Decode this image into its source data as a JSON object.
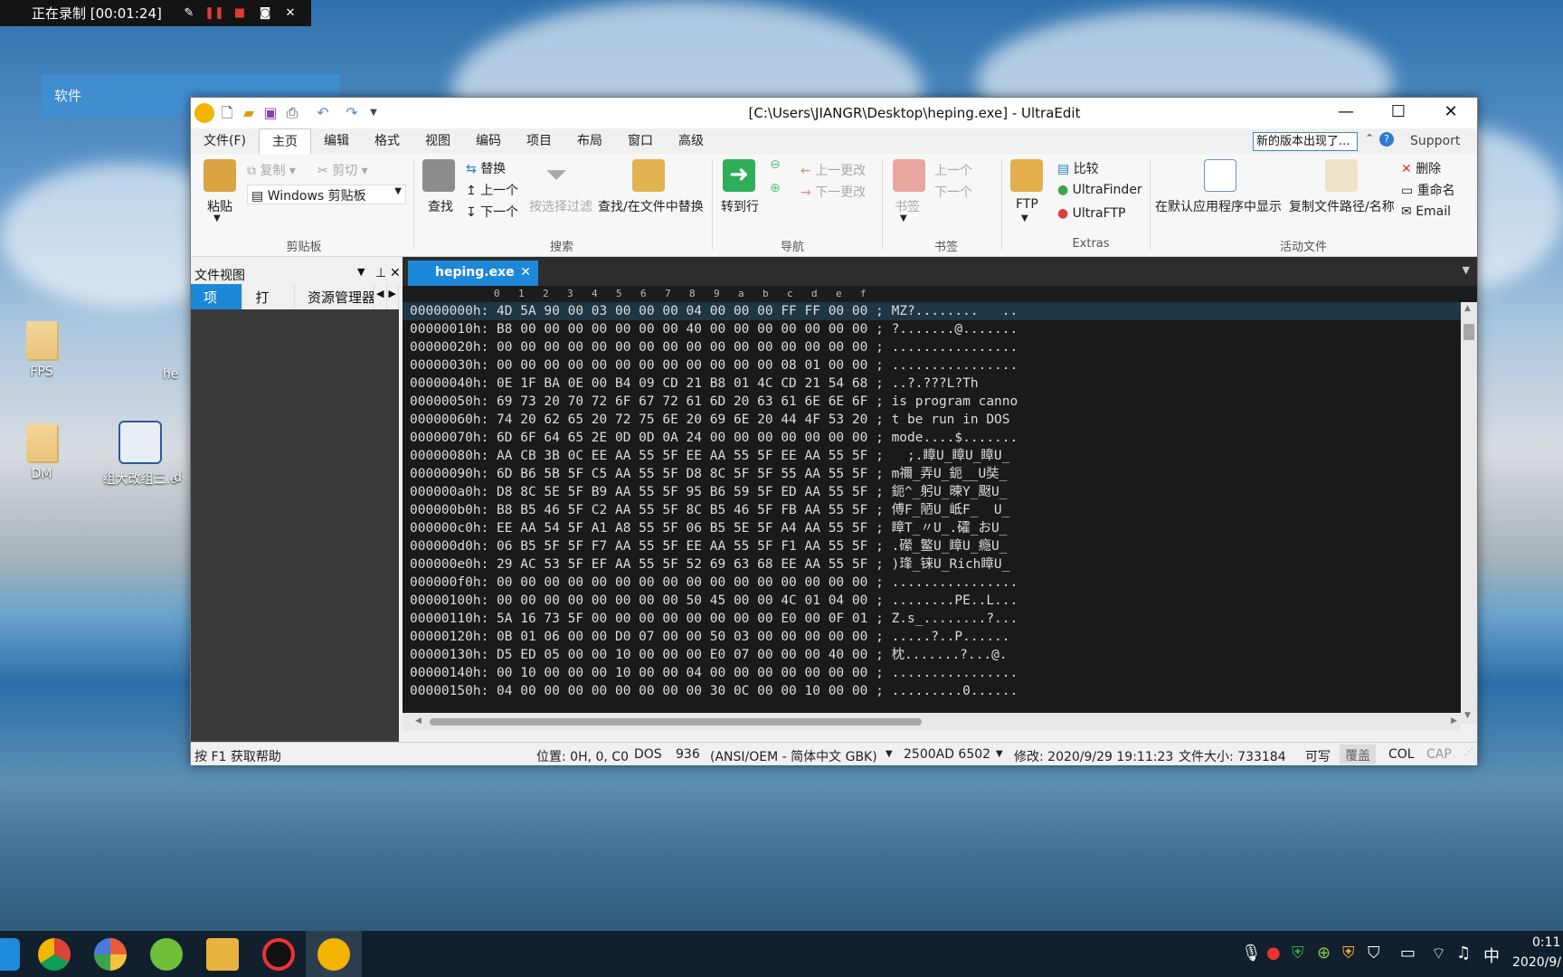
{
  "recorder": {
    "status": "正在录制 [00:01:24]",
    "buttons": [
      "pen-icon",
      "pause-icon",
      "stop-icon",
      "camera-icon",
      "close-icon"
    ]
  },
  "desktop": {
    "software_panel_label": "软件",
    "icons": [
      {
        "name": "FPS",
        "kind": "folder"
      },
      {
        "name": "DM",
        "kind": "folder"
      },
      {
        "name": "组大改组三.e",
        "kind": "app"
      },
      {
        "name": "he",
        "kind": "file"
      },
      {
        "name": "d",
        "kind": "file"
      }
    ]
  },
  "window": {
    "title": "[C:\\Users\\JIANGR\\Desktop\\heping.exe] - UltraEdit",
    "controls": {
      "minimize": "—",
      "maximize": "☐",
      "close": "✕"
    },
    "menu": [
      "文件(F)",
      "主页",
      "编辑",
      "格式",
      "视图",
      "编码",
      "项目",
      "布局",
      "窗口",
      "高级"
    ],
    "active_menu": "主页",
    "notice": "新的版本出现了...",
    "support": "Support"
  },
  "ribbon": {
    "clipboard": {
      "paste": "粘贴",
      "copy": "复制",
      "cut": "剪切",
      "clipboard_select": "Windows 剪贴板",
      "group": "剪贴板"
    },
    "search": {
      "find": "查找",
      "replace": "替换",
      "prev": "上一个",
      "next": "下一个",
      "filter": "按选择过滤",
      "find_in_files": "查找/在文件中替换",
      "group": "搜索"
    },
    "navigation": {
      "goto": "转到行",
      "prev_change": "上一更改",
      "next_change": "下一更改",
      "group": "导航"
    },
    "bookmarks": {
      "bookmark": "书签",
      "prev": "上一个",
      "next": "下一个",
      "group": "书签"
    },
    "extras": {
      "ftp": "FTP",
      "compare": "比较",
      "finder": "UltraFinder",
      "ultraftp": "UltraFTP",
      "group": "Extras"
    },
    "active_file": {
      "show_default": "在默认应用程序中显示",
      "copy_path": "复制文件路径/名称",
      "delete": "删除",
      "rename": "重命名",
      "email": "Email",
      "group": "活动文件"
    }
  },
  "file_view": {
    "title": "文件视图",
    "tabs": [
      "项目",
      "打开",
      "资源管理器"
    ],
    "active_tab": "项目"
  },
  "editor": {
    "tab_name": "heping.exe",
    "ruler": [
      "0",
      "1",
      "2",
      "3",
      "4",
      "5",
      "6",
      "7",
      "8",
      "9",
      "a",
      "b",
      "c",
      "d",
      "e",
      "f"
    ],
    "rows": [
      {
        "addr": "00000000h:",
        "hex": "4D 5A 90 00 03 00 00 00 04 00 00 00 FF FF 00 00",
        "ascii": "MZ?........   .."
      },
      {
        "addr": "00000010h:",
        "hex": "B8 00 00 00 00 00 00 00 40 00 00 00 00 00 00 00",
        "ascii": "?.......@......."
      },
      {
        "addr": "00000020h:",
        "hex": "00 00 00 00 00 00 00 00 00 00 00 00 00 00 00 00",
        "ascii": "................"
      },
      {
        "addr": "00000030h:",
        "hex": "00 00 00 00 00 00 00 00 00 00 00 00 08 01 00 00",
        "ascii": "................"
      },
      {
        "addr": "00000040h:",
        "hex": "0E 1F BA 0E 00 B4 09 CD 21 B8 01 4C CD 21 54 68",
        "ascii": "..?.???L?Th"
      },
      {
        "addr": "00000050h:",
        "hex": "69 73 20 70 72 6F 67 72 61 6D 20 63 61 6E 6E 6F",
        "ascii": "is program canno"
      },
      {
        "addr": "00000060h:",
        "hex": "74 20 62 65 20 72 75 6E 20 69 6E 20 44 4F 53 20",
        "ascii": "t be run in DOS "
      },
      {
        "addr": "00000070h:",
        "hex": "6D 6F 64 65 2E 0D 0D 0A 24 00 00 00 00 00 00 00",
        "ascii": "mode....$......."
      },
      {
        "addr": "00000080h:",
        "hex": "AA CB 3B 0C EE AA 55 5F EE AA 55 5F EE AA 55 5F",
        "ascii": "  ;.瞕U_瞕U_瞕U_"
      },
      {
        "addr": "00000090h:",
        "hex": "6D B6 5B 5F C5 AA 55 5F D8 8C 5F 5F 55 AA 55 5F",
        "ascii": "m禰_弄U_鈪__U奘_"
      },
      {
        "addr": "000000a0h:",
        "hex": "D8 8C 5E 5F B9 AA 55 5F 95 B6 59 5F ED AA 55 5F",
        "ascii": "鈪^_躬U_暕Y_颬U_"
      },
      {
        "addr": "000000b0h:",
        "hex": "B8 B5 46 5F C2 AA 55 5F 8C B5 46 5F FB AA 55 5F",
        "ascii": "傅F_陋U_岻F_  U_"
      },
      {
        "addr": "000000c0h:",
        "hex": "EE AA 54 5F A1 A8 55 5F 06 B5 5E 5F A4 AA 55 5F",
        "ascii": "瞕T_〃U_.礭_おU_"
      },
      {
        "addr": "000000d0h:",
        "hex": "06 B5 5F 5F F7 AA 55 5F EE AA 55 5F F1 AA 55 5F",
        "ascii": ".礯_鳘U_瞕U_瘾U_"
      },
      {
        "addr": "000000e0h:",
        "hex": "29 AC 53 5F EF AA 55 5F 52 69 63 68 EE AA 55 5F",
        "ascii": ")琒_铼U_Rich瞕U_"
      },
      {
        "addr": "000000f0h:",
        "hex": "00 00 00 00 00 00 00 00 00 00 00 00 00 00 00 00",
        "ascii": "................"
      },
      {
        "addr": "00000100h:",
        "hex": "00 00 00 00 00 00 00 00 50 45 00 00 4C 01 04 00",
        "ascii": "........PE..L..."
      },
      {
        "addr": "00000110h:",
        "hex": "5A 16 73 5F 00 00 00 00 00 00 00 00 E0 00 0F 01",
        "ascii": "Z.s_........?..."
      },
      {
        "addr": "00000120h:",
        "hex": "0B 01 06 00 00 D0 07 00 00 50 03 00 00 00 00 00",
        "ascii": ".....?..P......"
      },
      {
        "addr": "00000130h:",
        "hex": "D5 ED 05 00 00 10 00 00 00 E0 07 00 00 00 40 00",
        "ascii": "枕.......?...@."
      },
      {
        "addr": "00000140h:",
        "hex": "00 10 00 00 00 10 00 00 04 00 00 00 00 00 00 00",
        "ascii": "................"
      },
      {
        "addr": "00000150h:",
        "hex": "04 00 00 00 00 00 00 00 00 30 0C 00 00 10 00 00",
        "ascii": ".........0......"
      }
    ]
  },
  "status": {
    "help": "按 F1 获取帮助",
    "position": "位置: 0H, 0, C0",
    "line_ending": "DOS",
    "codepage": "936",
    "encoding": "(ANSI/OEM - 简体中文 GBK)",
    "layout": "2500AD 6502",
    "modified": "修改:   2020/9/29 19:11:23",
    "file_size": "文件大小:   733184",
    "writable": "可写",
    "overwrite": "覆盖",
    "col": "COL",
    "cap": "CAP"
  },
  "taskbar": {
    "apps": [
      "edge-icon",
      "chrome-icon",
      "chrome-alt-icon",
      "green-browser-icon",
      "file-explorer-icon",
      "recorder-icon",
      "ultraedit-icon"
    ],
    "ime": "中",
    "time": "0:11",
    "date": "2020/9/"
  },
  "colors": {
    "accent": "#1e88d8",
    "editor_bg": "#1a1a1a",
    "taskbar": "#12202d"
  }
}
